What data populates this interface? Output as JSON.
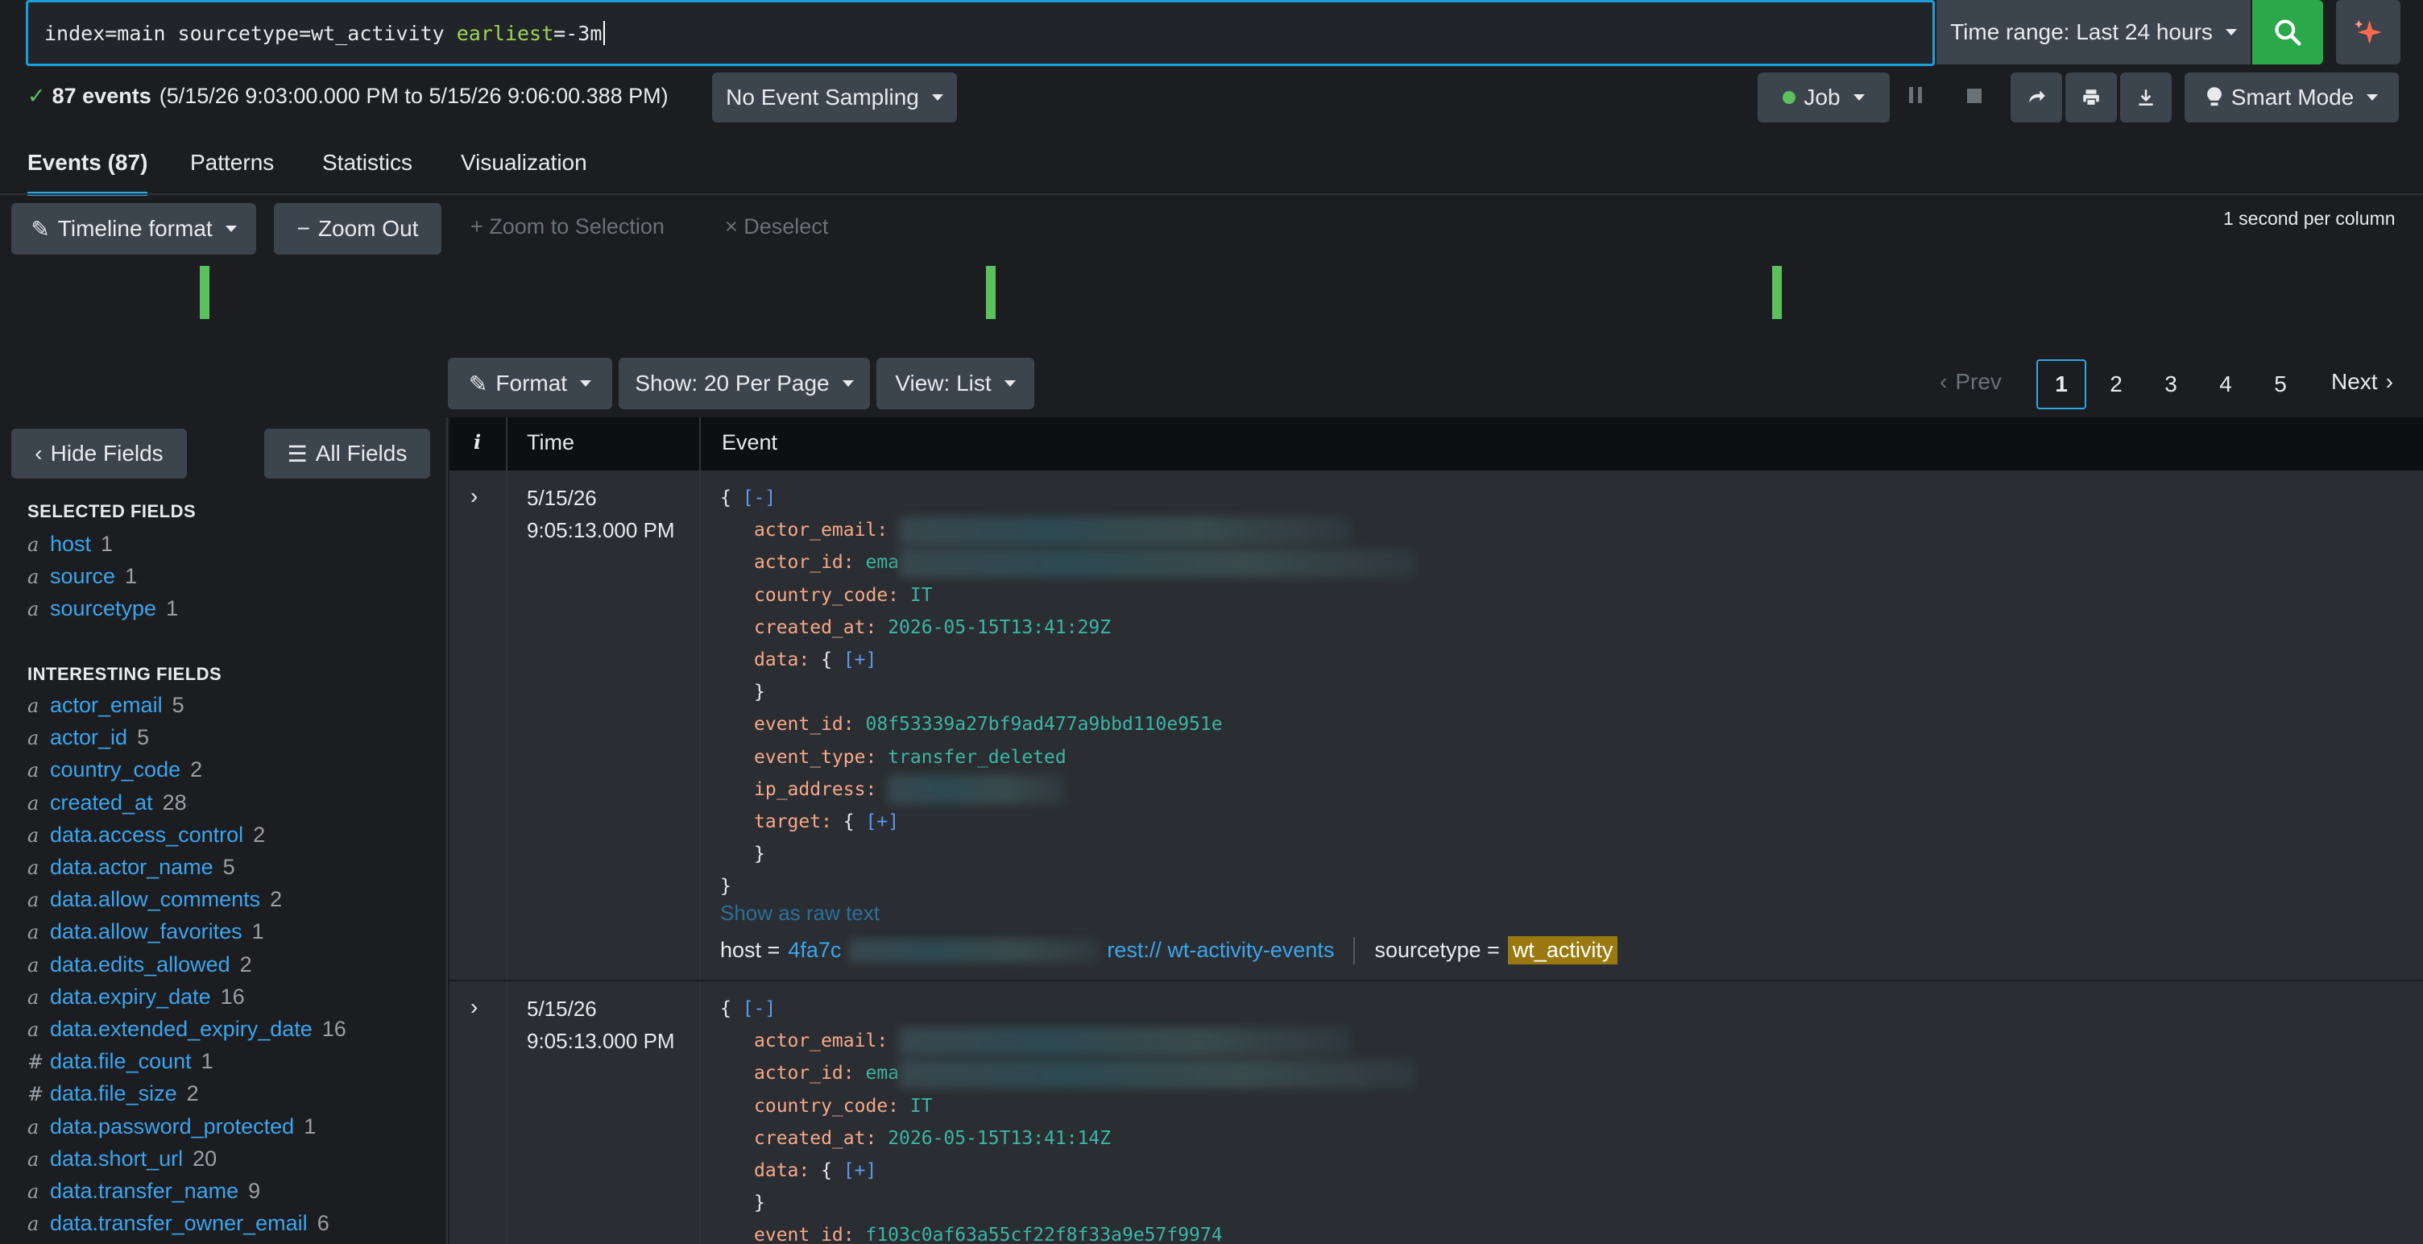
{
  "search": {
    "query_plain": "index=main sourcetype=wt_activity ",
    "query_keyword": "earliest",
    "query_tail": "=-3m",
    "time_range_label": "Time range: Last 24 hours"
  },
  "status": {
    "events_count": "87 events",
    "range": "(5/15/26 9:03:00.000 PM to 5/15/26 9:06:00.388 PM)",
    "sampling": "No Event Sampling",
    "job": "Job",
    "mode": "Smart Mode"
  },
  "tabs": [
    "Events (87)",
    "Patterns",
    "Statistics",
    "Visualization"
  ],
  "timeline": {
    "format": "Timeline format",
    "zoom_out": "Zoom Out",
    "zoom_to_selection": "+ Zoom to Selection",
    "deselect": "× Deselect",
    "scale": "1 second per column"
  },
  "results_toolbar": {
    "format": "Format",
    "show": "Show: 20 Per Page",
    "view": "View: List",
    "prev": "Prev",
    "pages": [
      "1",
      "2",
      "3",
      "4",
      "5"
    ],
    "next": "Next"
  },
  "sidebar": {
    "hide_fields": "Hide Fields",
    "all_fields": "All Fields",
    "selected_title": "SELECTED FIELDS",
    "selected": [
      {
        "type": "a",
        "name": "host",
        "count": "1"
      },
      {
        "type": "a",
        "name": "source",
        "count": "1"
      },
      {
        "type": "a",
        "name": "sourcetype",
        "count": "1"
      }
    ],
    "interesting_title": "INTERESTING FIELDS",
    "interesting": [
      {
        "type": "a",
        "name": "actor_email",
        "count": "5"
      },
      {
        "type": "a",
        "name": "actor_id",
        "count": "5"
      },
      {
        "type": "a",
        "name": "country_code",
        "count": "2"
      },
      {
        "type": "a",
        "name": "created_at",
        "count": "28"
      },
      {
        "type": "a",
        "name": "data.access_control",
        "count": "2"
      },
      {
        "type": "a",
        "name": "data.actor_name",
        "count": "5"
      },
      {
        "type": "a",
        "name": "data.allow_comments",
        "count": "2"
      },
      {
        "type": "a",
        "name": "data.allow_favorites",
        "count": "1"
      },
      {
        "type": "a",
        "name": "data.edits_allowed",
        "count": "2"
      },
      {
        "type": "a",
        "name": "data.expiry_date",
        "count": "16"
      },
      {
        "type": "a",
        "name": "data.extended_expiry_date",
        "count": "16"
      },
      {
        "type": "#",
        "name": "data.file_count",
        "count": "1"
      },
      {
        "type": "#",
        "name": "data.file_size",
        "count": "2"
      },
      {
        "type": "a",
        "name": "data.password_protected",
        "count": "1"
      },
      {
        "type": "a",
        "name": "data.short_url",
        "count": "20"
      },
      {
        "type": "a",
        "name": "data.transfer_name",
        "count": "9"
      },
      {
        "type": "a",
        "name": "data.transfer_owner_email",
        "count": "6"
      }
    ]
  },
  "table": {
    "col_info": "i",
    "col_time": "Time",
    "col_event": "Event"
  },
  "events": [
    {
      "date": "5/15/26",
      "time": "9:05:13.000 PM",
      "open": "{ ",
      "collapse": "[-]",
      "actor_email_key": "actor_email:",
      "actor_id_key": "actor_id:",
      "actor_id_val": "ema",
      "country_code_key": "country_code:",
      "country_code_val": "IT",
      "created_at_key": "created_at:",
      "created_at_val": "2026-05-15T13:41:29Z",
      "data_key": "data:",
      "expand": "[+]",
      "event_id_key": "event_id:",
      "event_id_val": "08f53339a27bf9ad477a9bbd110e951e",
      "event_type_key": "event_type:",
      "event_type_val": "transfer_deleted",
      "ip_address_key": "ip_address:",
      "target_key": "target:",
      "raw_link": "Show as raw text",
      "host_label": "host =",
      "host_val": "4fa7c",
      "source_val": "rest:// wt-activity-events",
      "sourcetype_label": "sourcetype =",
      "sourcetype_val": "wt_activity"
    },
    {
      "date": "5/15/26",
      "time": "9:05:13.000 PM",
      "open": "{ ",
      "collapse": "[-]",
      "actor_email_key": "actor_email:",
      "actor_id_key": "actor_id:",
      "actor_id_val": "ema",
      "country_code_key": "country_code:",
      "country_code_val": "IT",
      "created_at_key": "created_at:",
      "created_at_val": "2026-05-15T13:41:14Z",
      "data_key": "data:",
      "expand": "[+]",
      "event_id_key": "event_id:",
      "event_id_val": "f103c0af63a55cf22f8f33a9e57f9974"
    }
  ],
  "colors": {
    "accent": "#2ea6e6",
    "success": "#2aa84a",
    "field_link": "#3ba5ee",
    "highlight": "#9a7a10"
  }
}
